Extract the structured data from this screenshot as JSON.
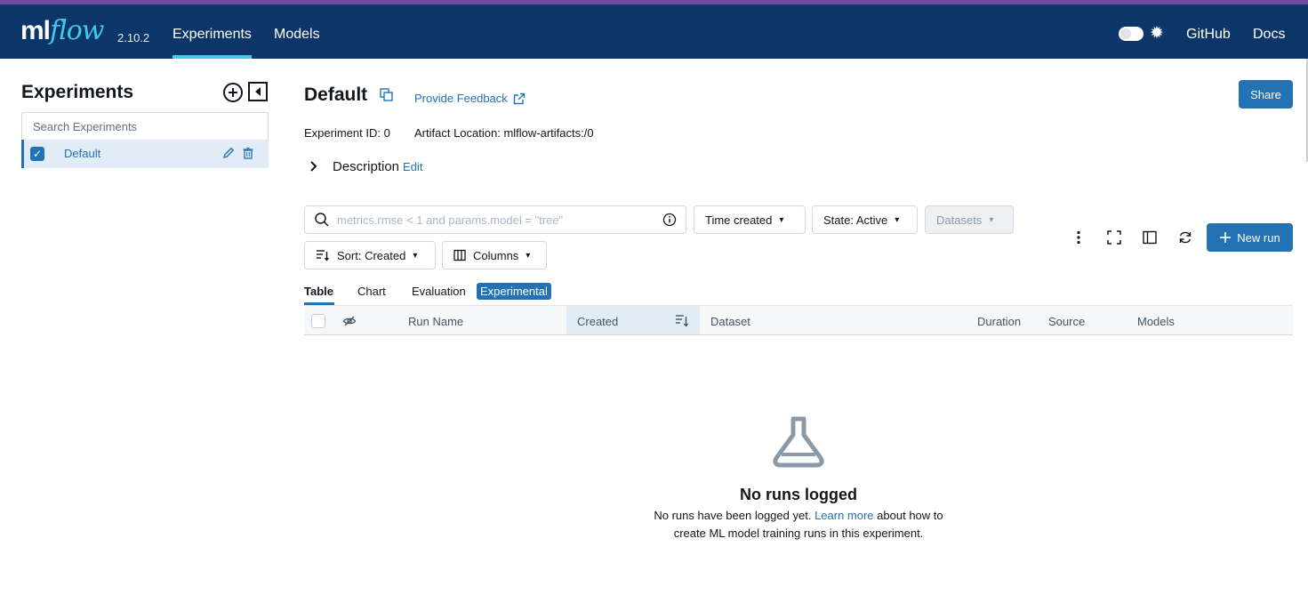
{
  "app": {
    "logo_ml": "ml",
    "logo_flow": "flow",
    "version": "2.10.2",
    "accent": "#2272b4",
    "navbar_color": "#0c3667"
  },
  "nav": {
    "experiments": "Experiments",
    "models": "Models",
    "github": "GitHub",
    "docs": "Docs"
  },
  "sidebar": {
    "title": "Experiments",
    "search_placeholder": "Search Experiments",
    "items": [
      {
        "label": "Default",
        "checked": true
      }
    ]
  },
  "experiment": {
    "title": "Default",
    "feedback": "Provide Feedback",
    "share": "Share",
    "id_text": "Experiment ID: 0",
    "artifact_text": "Artifact Location: mlflow-artifacts:/0",
    "description_label": "Description",
    "edit_label": "Edit"
  },
  "controls": {
    "filter_placeholder": "metrics.rmse < 1 and params.model = \"tree\"",
    "time_created": "Time created",
    "state": "State: Active",
    "datasets": "Datasets",
    "sort": "Sort: Created",
    "columns": "Columns",
    "new_run": "New run"
  },
  "tabs": {
    "table": "Table",
    "chart": "Chart",
    "evaluation": "Evaluation",
    "experimental": "Experimental"
  },
  "table": {
    "columns": [
      "Run Name",
      "Created",
      "Dataset",
      "Duration",
      "Source",
      "Models"
    ]
  },
  "empty": {
    "title": "No runs logged",
    "line1_prefix": "No runs have been logged yet.",
    "learn_more": "Learn more",
    "line1_suffix": "about how to",
    "line2": "create ML model training runs in this experiment."
  }
}
